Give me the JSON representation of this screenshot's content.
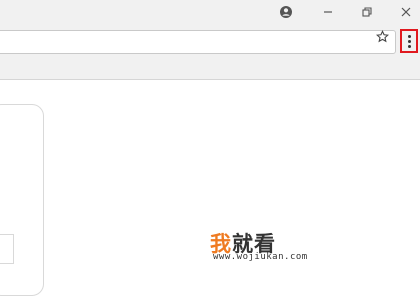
{
  "titlebar": {
    "icons": [
      "account-icon",
      "minimize-icon",
      "restore-icon",
      "close-icon"
    ]
  },
  "toolbar": {
    "address_value": "",
    "star_icon": "star-outline-icon",
    "menu_icon": "vertical-dots-icon",
    "highlight_color": "#e0191f"
  },
  "watermark": {
    "char1": "我",
    "char2": "就看",
    "url": "www.wojiukan.com",
    "accent_color": "#ef7b22"
  }
}
